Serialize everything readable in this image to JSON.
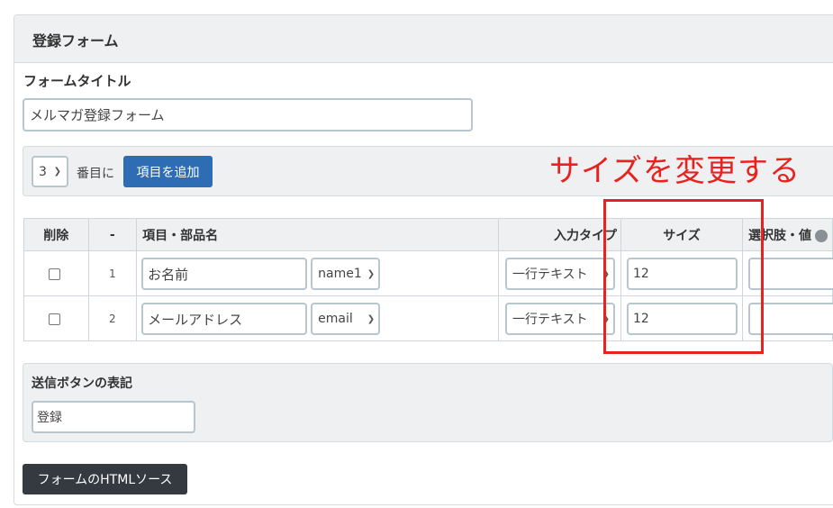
{
  "form": {
    "panel_title": "登録フォーム",
    "form_title_label": "フォームタイトル",
    "form_title_value": "メルマガ登録フォーム",
    "position_value": "3",
    "position_suffix": "番目に",
    "add_item_label": "項目を追加",
    "annotation": "サイズを変更する",
    "annotation_color": "#e8231f"
  },
  "table": {
    "headers": [
      "削除",
      "-",
      "項目・部品名",
      "入力タイプ",
      "サイズ",
      "選択肢・値"
    ],
    "rows": [
      {
        "num": "1",
        "name": "お名前",
        "field": "name1",
        "type": "一行テキスト",
        "size": "12"
      },
      {
        "num": "2",
        "name": "メールアドレス",
        "field": "email",
        "type": "一行テキスト",
        "size": "12"
      }
    ]
  },
  "submit": {
    "label": "送信ボタンの表記",
    "value": "登録"
  },
  "html_source_button": "フォームのHTMLソース",
  "colors": {
    "primary": "#2e6db4",
    "dark": "#343a40",
    "panel_bg": "#eef0f2"
  }
}
